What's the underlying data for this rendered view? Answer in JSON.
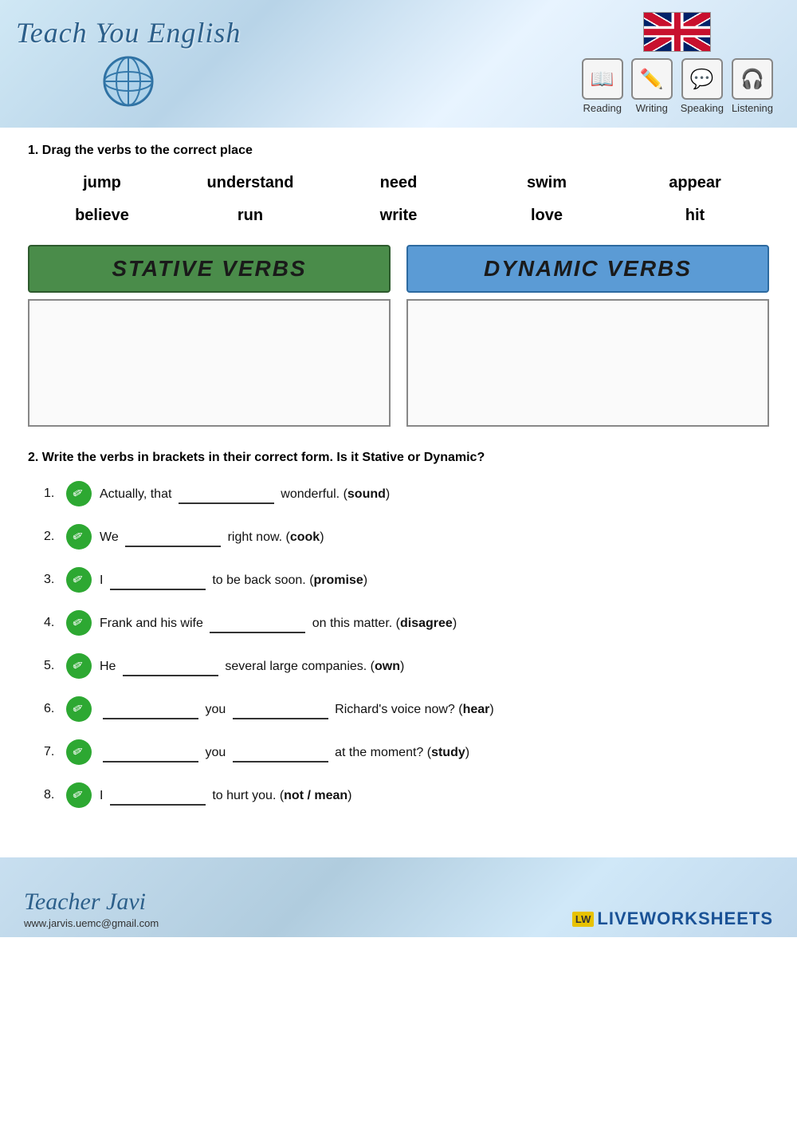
{
  "header": {
    "logo_text": "Teach You English",
    "skills": [
      {
        "label": "Reading",
        "icon": "📖"
      },
      {
        "label": "Writing",
        "icon": "✏️"
      },
      {
        "label": "Speaking",
        "icon": "💬"
      },
      {
        "label": "Listening",
        "icon": "🎧"
      }
    ]
  },
  "section1": {
    "instruction": "1. Drag the verbs to the correct place",
    "verbs_row1": [
      "jump",
      "understand",
      "need",
      "swim",
      "appear"
    ],
    "verbs_row2": [
      "believe",
      "run",
      "write",
      "love",
      "hit"
    ],
    "stative_label": "STATIVE VERBS",
    "dynamic_label": "DYNAMIC VERBS"
  },
  "section2": {
    "instruction": "2. Write the verbs in brackets in their correct form. Is it Stative or Dynamic?",
    "exercises": [
      {
        "num": "1.",
        "text_before": "Actually, that",
        "blank1": true,
        "text_after": "wonderful.",
        "verb": "sound"
      },
      {
        "num": "2.",
        "text_before": "We",
        "blank1": true,
        "text_after": "right now.",
        "verb": "cook"
      },
      {
        "num": "3.",
        "text_before": "I",
        "blank1": true,
        "text_after": "to be back soon.",
        "verb": "promise"
      },
      {
        "num": "4.",
        "text_before": "Frank and his wife",
        "blank1": true,
        "text_after": "on this matter.",
        "verb": "disagree"
      },
      {
        "num": "5.",
        "text_before": "He",
        "blank1": true,
        "text_after": "several large companies.",
        "verb": "own"
      },
      {
        "num": "6.",
        "text_before": "",
        "blank1": true,
        "text_middle": "you",
        "blank2": true,
        "text_after": "Richard's voice now?",
        "verb": "hear"
      },
      {
        "num": "7.",
        "text_before": "",
        "blank1": true,
        "text_middle": "you",
        "blank2": true,
        "text_after": "at the moment?",
        "verb": "study"
      },
      {
        "num": "8.",
        "text_before": "I",
        "blank1": true,
        "text_after": "to hurt you.",
        "verb": "not / mean"
      }
    ]
  },
  "footer": {
    "teacher_name": "Teacher Javi",
    "website": "www.jarvis.uemc@gmail.com",
    "brand": "LIVEWORKSHEETS",
    "brand_badge": "LW"
  }
}
